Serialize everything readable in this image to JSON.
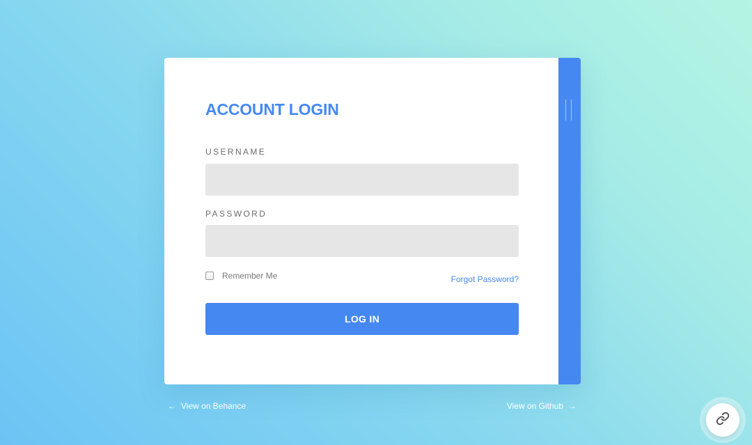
{
  "form": {
    "title": "ACCOUNT LOGIN",
    "username_label": "USERNAME",
    "username_value": "",
    "password_label": "PASSWORD",
    "password_value": "",
    "remember_label": "Remember Me",
    "remember_checked": false,
    "forgot_label": "Forgot Password?",
    "login_label": "LOG IN"
  },
  "footer": {
    "behance_label": "View on Behance",
    "github_label": "View on Github"
  },
  "icons": {
    "arrow_left": "arrow-left-icon",
    "arrow_right": "arrow-right-icon",
    "fab": "link-icon",
    "side_tab": "grip-handle-icon"
  },
  "colors": {
    "accent": "#4688f1",
    "field_bg": "#e6e6e6",
    "card_bg": "#ffffff",
    "label": "#6b6b6b",
    "background_start": "#6cc4f5",
    "background_end": "#b3f5e4"
  }
}
